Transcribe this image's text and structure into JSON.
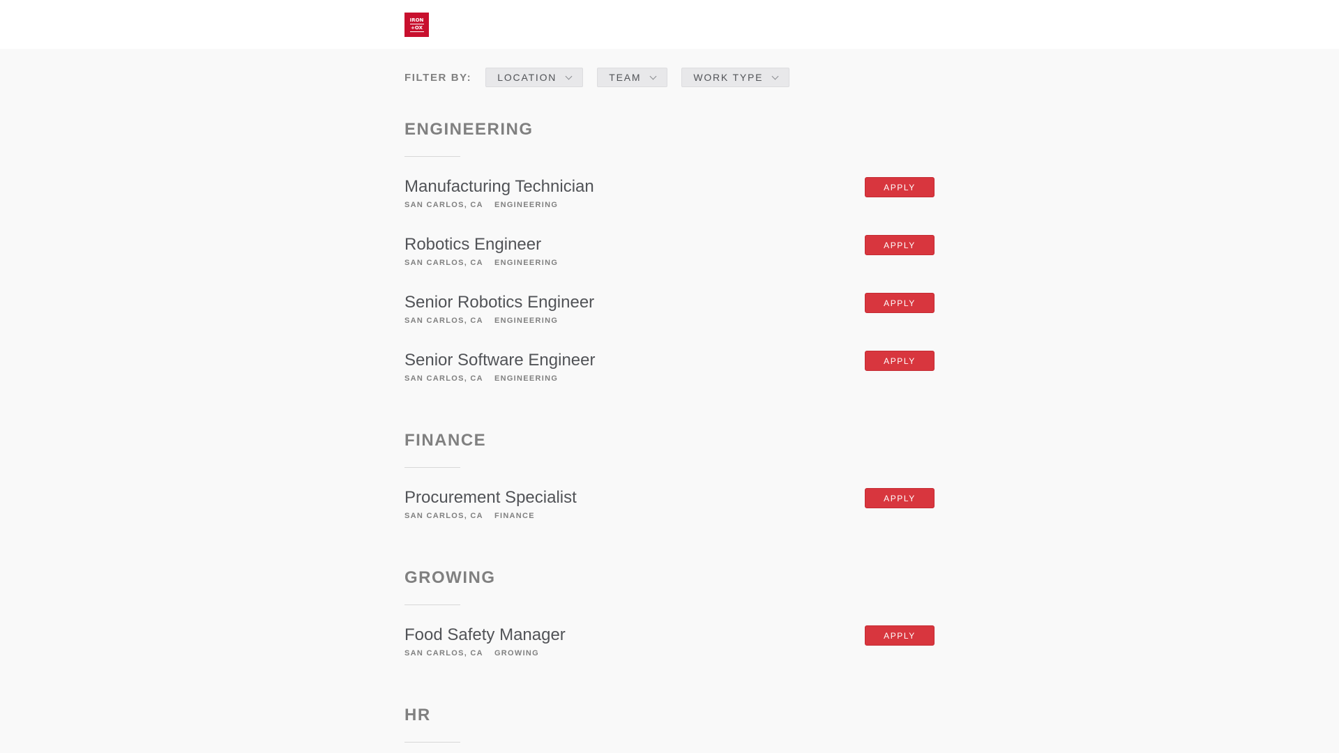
{
  "header": {
    "logo_line1": "IRON",
    "logo_line2": "OX",
    "logo_symbol": "+"
  },
  "filters": {
    "label": "FILTER BY:",
    "buttons": [
      {
        "label": "LOCATION",
        "icon": "chevron-down-icon"
      },
      {
        "label": "TEAM",
        "icon": "chevron-down-icon"
      },
      {
        "label": "WORK TYPE",
        "icon": "chevron-down-icon"
      }
    ]
  },
  "sections": [
    {
      "title": "ENGINEERING",
      "postings": [
        {
          "title": "Manufacturing Technician",
          "location": "SAN CARLOS, CA",
          "team": "ENGINEERING",
          "apply_label": "APPLY"
        },
        {
          "title": "Robotics Engineer",
          "location": "SAN CARLOS, CA",
          "team": "ENGINEERING",
          "apply_label": "APPLY"
        },
        {
          "title": "Senior Robotics Engineer",
          "location": "SAN CARLOS, CA",
          "team": "ENGINEERING",
          "apply_label": "APPLY"
        },
        {
          "title": "Senior Software Engineer",
          "location": "SAN CARLOS, CA",
          "team": "ENGINEERING",
          "apply_label": "APPLY"
        }
      ]
    },
    {
      "title": "FINANCE",
      "postings": [
        {
          "title": "Procurement Specialist",
          "location": "SAN CARLOS, CA",
          "team": "FINANCE",
          "apply_label": "APPLY"
        }
      ]
    },
    {
      "title": "GROWING",
      "postings": [
        {
          "title": "Food Safety Manager",
          "location": "SAN CARLOS, CA",
          "team": "GROWING",
          "apply_label": "APPLY"
        }
      ]
    },
    {
      "title": "HR",
      "postings": []
    }
  ],
  "colors": {
    "brand": "#c8102e",
    "apply_button": "#d8363e",
    "page_background": "#f9f9f9",
    "header_background": "#ffffff"
  }
}
